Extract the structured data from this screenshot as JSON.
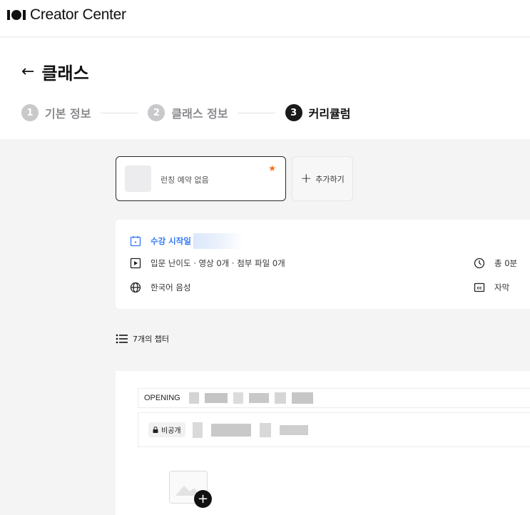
{
  "app": {
    "title": "Creator Center"
  },
  "header": {
    "page_title": "클래스",
    "steps": [
      {
        "num": "1",
        "label": "기본 정보"
      },
      {
        "num": "2",
        "label": "클래스 정보"
      },
      {
        "num": "3",
        "label": "커리큘럼"
      }
    ]
  },
  "launch": {
    "text": "런칭 예약 없음",
    "add_label": "추가하기"
  },
  "info": {
    "start_label": "수강 시작일",
    "level_text": "입문 난이도 · 영상 0개 · 첨부 파일 0개",
    "language_text": "한국어 음성",
    "duration_text": "총 0분",
    "subtitle_text": "자막"
  },
  "chapters": {
    "count_label": "7개의 챕터",
    "first": {
      "title_prefix": "OPENING",
      "lesson_badge": "비공개"
    }
  },
  "colors": {
    "accent_blue": "#3478f6",
    "star_orange": "#ff6a13"
  }
}
